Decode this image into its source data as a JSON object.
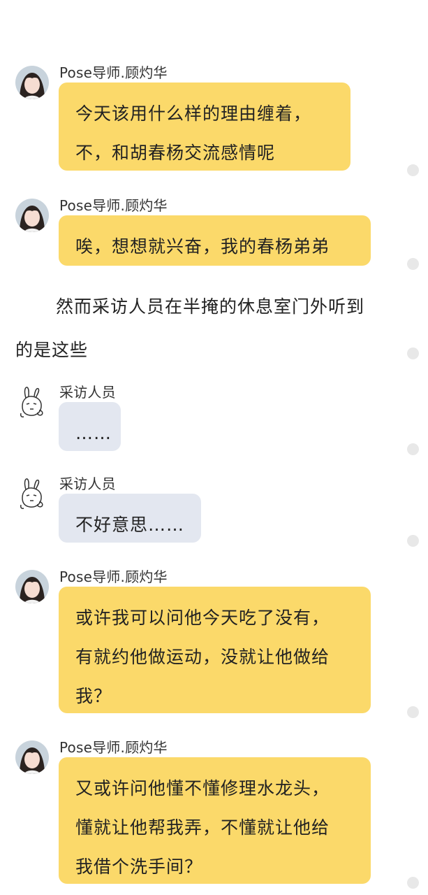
{
  "messages": [
    {
      "sender": "Pose导师.顾灼华",
      "avatar_icon": "girl-portrait-avatar",
      "lines": [
        "今天该用什么样的理由缠着，",
        "不，和胡春杨交流感情呢"
      ]
    },
    {
      "sender": "Pose导师.顾灼华",
      "avatar_icon": "girl-portrait-avatar",
      "lines": [
        "唉，想想就兴奋，我的春杨弟弟"
      ]
    },
    {
      "sender": "采访人员",
      "avatar_icon": "bunny-doodle-avatar",
      "lines": [
        "……"
      ]
    },
    {
      "sender": "采访人员",
      "avatar_icon": "bunny-doodle-avatar",
      "lines": [
        "不好意思……"
      ]
    },
    {
      "sender": "Pose导师.顾灼华",
      "avatar_icon": "girl-portrait-avatar",
      "lines": [
        "或许我可以问他今天吃了没有，",
        "有就约他做运动，没就让他做给",
        "我？"
      ]
    },
    {
      "sender": "Pose导师.顾灼华",
      "avatar_icon": "girl-portrait-avatar",
      "lines": [
        "又或许问他懂不懂修理水龙头，",
        "懂就让他帮我弄，不懂就让他给",
        "我借个洗手间？"
      ]
    }
  ],
  "narration": {
    "lines": [
      "然而采访人员在半掩的休息室门外听到",
      "的是这些"
    ]
  },
  "colors": {
    "bubble_yellow": "#fbd96a",
    "bubble_gray": "#e3e7f0",
    "background": "#ffffff"
  }
}
